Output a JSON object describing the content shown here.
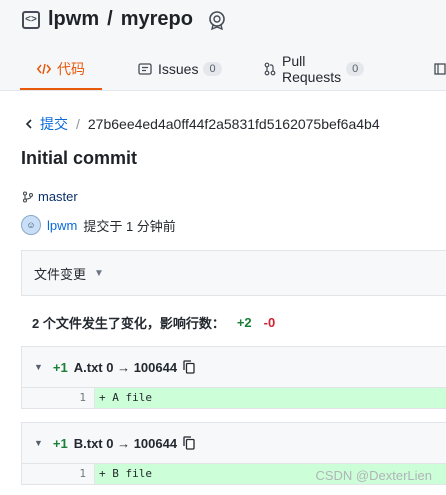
{
  "repo": {
    "owner": "lpwm",
    "separator": "/",
    "name": "myrepo"
  },
  "tabs": {
    "code": "代码",
    "issues": {
      "label": "Issues",
      "count": "0"
    },
    "pulls": {
      "label": "Pull Requests",
      "count": "0"
    }
  },
  "commit": {
    "back_label": "提交",
    "separator": "/",
    "sha": "27b6ee4ed4a0ff44f2a5831fd5162075bef6a4b4",
    "title": "Initial commit",
    "branch": "master",
    "author": "lpwm",
    "committed_text": "提交于 1 分钟前"
  },
  "changes": {
    "dropdown_label": "文件变更",
    "summary": "2 个文件发生了变化，影响行数：",
    "additions": "+2",
    "deletions": "-0"
  },
  "files": [
    {
      "additions": "+1",
      "header": "A.txt 0 → 100644",
      "line_number": "1",
      "code": "+ A file"
    },
    {
      "additions": "+1",
      "header": "B.txt 0 → 100644",
      "line_number": "1",
      "code": "+ B file"
    }
  ],
  "watermark": "CSDN @DexterLien",
  "colors": {
    "accent": "#e8590c",
    "link": "#0969da",
    "added": "#1a7f37",
    "deleted": "#cf222e",
    "added_bg": "#ccffd8"
  }
}
